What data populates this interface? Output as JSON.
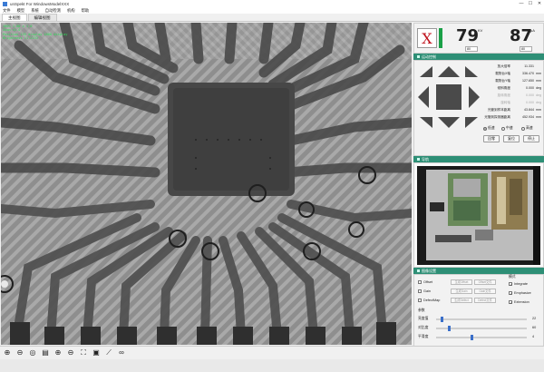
{
  "window": {
    "title": "unSpekt For WindowsModelXXX",
    "minimize": "—",
    "maximize": "☐",
    "close": "✕"
  },
  "menu": [
    "文件",
    "模型",
    "系统",
    "自动检测",
    "机构",
    "帮助"
  ],
  "tabs": [
    {
      "label": "主视图",
      "active": true
    },
    {
      "label": "编辑视图",
      "active": false
    }
  ],
  "overlay": [
    "100% 1.00 x 1.0",
    "Zoom x1.0",
    "Position 135 display 1000 display",
    "Brightness 11.2233"
  ],
  "xray": {
    "status_symbol": "X",
    "status_color": "#c0141e",
    "ready_color": "#1aa047",
    "kv": "79",
    "kv_unit": "KV",
    "ua": "87",
    "ua_unit": "μA",
    "kv_spin": "80",
    "ua_spin": "80"
  },
  "motion": {
    "header": "运动控制",
    "rows": [
      {
        "label": "放大倍率",
        "value": "11.331",
        "unit": ""
      },
      {
        "label": "载物台X轴",
        "value": "336.470",
        "unit": "mm"
      },
      {
        "label": "载物台Y轴",
        "value": "127.650",
        "mm_unit": "mm",
        "unit": "mm"
      },
      {
        "label": "倾斜角度",
        "value": "0.000",
        "unit": "deg"
      },
      {
        "label": "旋转角度",
        "value": "0.000",
        "unit": "deg"
      },
      {
        "label": "旋转轴",
        "value": "0.000",
        "unit": "deg"
      },
      {
        "label": "光管到样本距离",
        "value": "43.844",
        "unit": "mm"
      },
      {
        "label": "光管到探测器距离",
        "value": "452.934",
        "unit": "mm"
      }
    ],
    "speed": [
      {
        "label": "低速",
        "selected": true
      },
      {
        "label": "中速",
        "selected": false
      },
      {
        "label": "高速",
        "selected": false
      }
    ],
    "buttons": [
      "回零",
      "复位",
      "停止"
    ]
  },
  "navigation": {
    "header": "导航"
  },
  "settings": {
    "header": "图像设置",
    "left_options": [
      {
        "label": "Offset",
        "checked": false,
        "btn1": "生成Offset",
        "btn2": "Offset文件"
      },
      {
        "label": "Gain",
        "checked": false,
        "btn1": "生成Gain",
        "btn2": "Gain文件"
      },
      {
        "label": "DefectMap",
        "checked": false,
        "btn1": "生成Defect",
        "btn2": "Defect文件"
      }
    ],
    "right_title": "模式",
    "right_options": [
      {
        "label": "Integrate",
        "checked": true
      },
      {
        "label": "Emphasize",
        "checked": true
      },
      {
        "label": "Extension",
        "checked": true
      }
    ],
    "sliders_title": "参数",
    "sliders": [
      {
        "label": "亮度值",
        "value": "22",
        "fraction": 0.05
      },
      {
        "label": "对比度",
        "value": "60",
        "fraction": 0.13
      },
      {
        "label": "平滑度",
        "value": "4",
        "fraction": 0.38
      }
    ]
  },
  "toolbar_icons": [
    "plus-circle-icon",
    "minus-circle-icon",
    "camera-icon",
    "save-icon",
    "zoom-in-icon",
    "zoom-out-icon",
    "fit-icon",
    "crop-icon",
    "measure-icon",
    "link-icon"
  ],
  "toolbar_glyphs": [
    "⊕",
    "⊖",
    "◎",
    "▤",
    "⊕",
    "⊖",
    "⛶",
    "▣",
    "⟋",
    "∞"
  ]
}
